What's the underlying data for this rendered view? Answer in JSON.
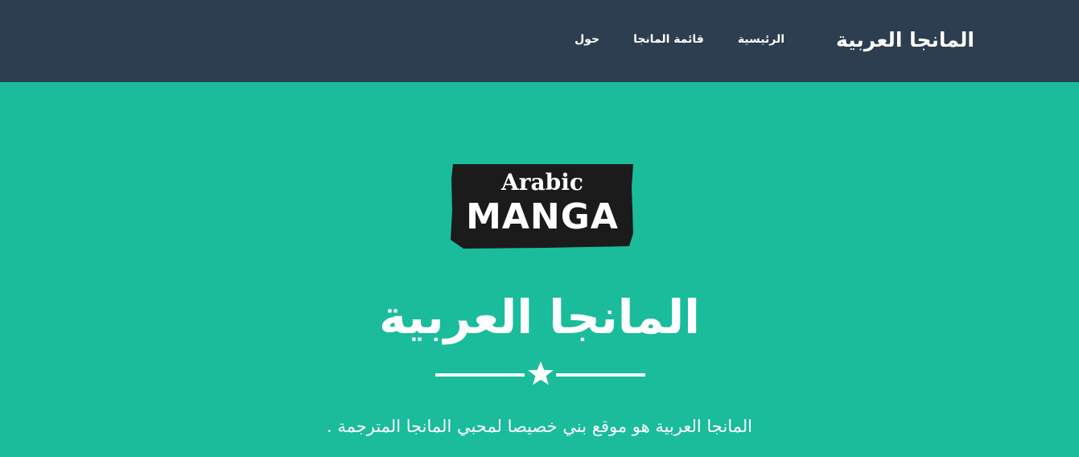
{
  "navbar": {
    "brand": "المانجا العربية",
    "links": [
      {
        "label": "الرئيسية"
      },
      {
        "label": "قائمة المانجا"
      },
      {
        "label": "حول"
      }
    ]
  },
  "hero": {
    "logo": {
      "line1": "Arabic",
      "line2": "MANGA"
    },
    "title": "المانجا العربية",
    "subtitle": "المانجا العربية هو موقع بني خصيصا لمحبي المانجا المترجمة ."
  },
  "colors": {
    "navbar_bg": "#2c3e50",
    "hero_bg": "#1abc9c",
    "text": "#ffffff",
    "logo_bg": "#1b1b1b"
  },
  "icons": {
    "divider": "star-icon"
  }
}
